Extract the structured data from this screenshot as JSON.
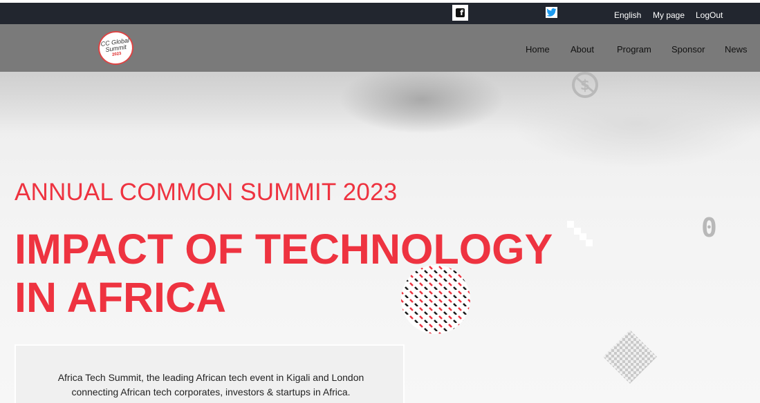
{
  "topbar": {
    "facebook_icon": "facebook-icon",
    "twitter_icon": "twitter-icon",
    "language": "English",
    "mypage": "My page",
    "logout": "LogOut"
  },
  "navbar": {
    "logo": {
      "line1": "CC Global",
      "line2": "Summit",
      "line3": "2023"
    },
    "items": [
      "Home",
      "About",
      "Program",
      "Sponsor",
      "News"
    ]
  },
  "hero": {
    "subtitle": "ANNUAL COMMON SUMMIT 2023",
    "title_line1": "IMPACT OF TECHNOLOGY",
    "title_line2": "IN AFRICA",
    "decor_glyph": "0",
    "description_line1": "Africa Tech Summit, the leading African tech event in Kigali and London",
    "description_line2": "connecting African tech corporates, investors & startups in Africa."
  },
  "colors": {
    "topbar_bg": "#22262f",
    "navbar_bg": "#7a7a7a",
    "accent_red": "#ee3340",
    "twitter_blue": "#1d9bf0"
  }
}
